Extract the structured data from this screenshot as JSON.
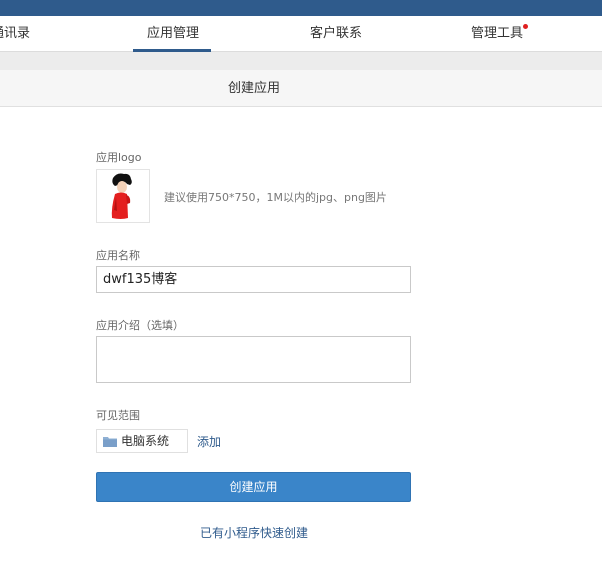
{
  "nav": {
    "items": [
      {
        "label": "通讯录",
        "active": false
      },
      {
        "label": "应用管理",
        "active": true
      },
      {
        "label": "客户联系",
        "active": false
      },
      {
        "label": "管理工具",
        "active": false,
        "badge": true
      }
    ]
  },
  "page": {
    "title": "创建应用"
  },
  "form": {
    "logo_label": "应用logo",
    "logo_hint": "建议使用750*750，1M以内的jpg、png图片",
    "logo_icon": "avatar-image",
    "name_label": "应用名称",
    "name_value": "dwf135博客",
    "intro_label": "应用介绍（选填）",
    "intro_value": "",
    "scope_label": "可见范围",
    "scope_item": "电脑系统",
    "scope_icon": "folder-icon",
    "add_label": "添加",
    "submit_label": "创建应用",
    "quick_create_label": "已有小程序快速创建"
  },
  "colors": {
    "brand": "#2f5b8c",
    "button": "#3a85c9",
    "badge": "#e02020"
  }
}
